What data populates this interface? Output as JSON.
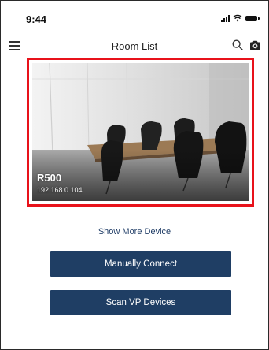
{
  "status_bar": {
    "time": "9:44",
    "icons": [
      "signal-icon",
      "wifi-icon",
      "battery-icon"
    ]
  },
  "nav": {
    "title": "Room List",
    "icons": [
      "menu-icon",
      "search-icon",
      "camera-icon"
    ]
  },
  "device_card": {
    "name": "R500",
    "ip": "192.168.0.104",
    "highlight_color": "#e8121b"
  },
  "actions": {
    "show_more": "Show More Device",
    "manual_connect": "Manually Connect",
    "scan_vp": "Scan VP Devices"
  },
  "colors": {
    "button_bg": "#1f3e64",
    "link": "#1f3c66"
  }
}
